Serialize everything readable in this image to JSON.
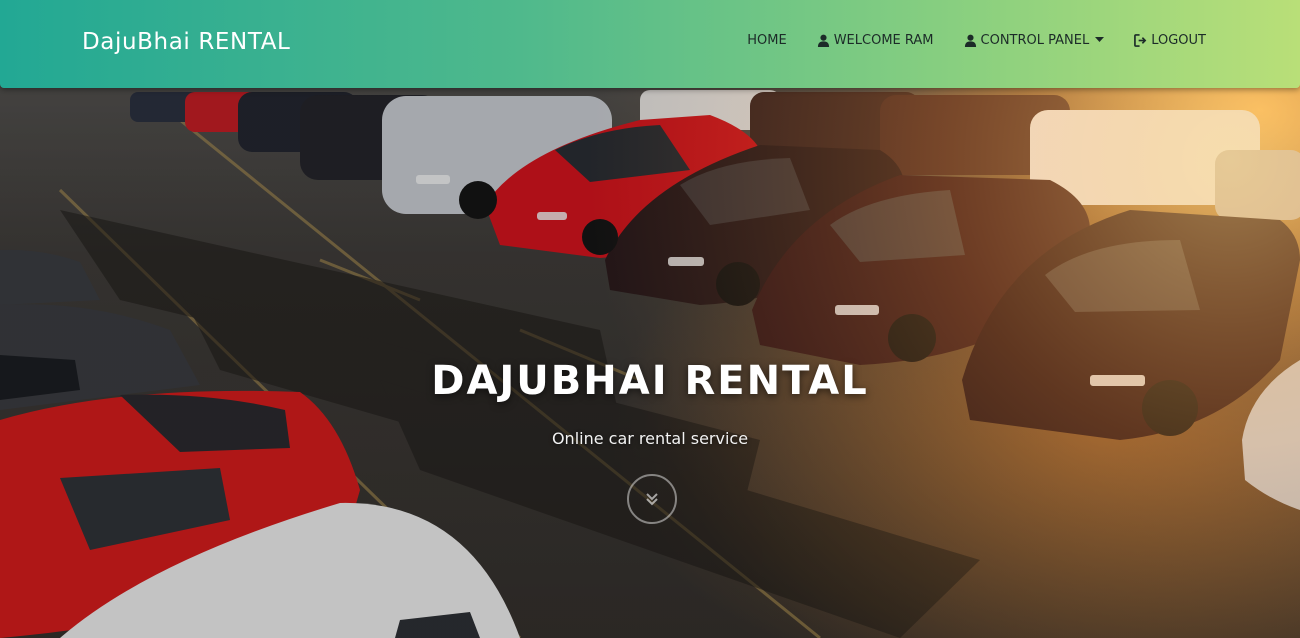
{
  "navbar": {
    "brand": "DajuBhai RENTAL",
    "items": [
      {
        "label": "HOME",
        "icon": "none"
      },
      {
        "label": "WELCOME RAM",
        "icon": "user-icon"
      },
      {
        "label": "CONTROL PANEL",
        "icon": "user-icon",
        "dropdown": true
      },
      {
        "label": "LOGOUT",
        "icon": "logout-icon"
      }
    ]
  },
  "hero": {
    "title": "DAJUBHAI RENTAL",
    "subtitle": "Online car rental service",
    "scroll_icon": "double-chevron-down-icon"
  },
  "colors": {
    "navbar_gradient_start": "#22a894",
    "navbar_gradient_end": "#b9df78",
    "nav_text": "#1c2b28",
    "hero_text": "#ffffff"
  }
}
